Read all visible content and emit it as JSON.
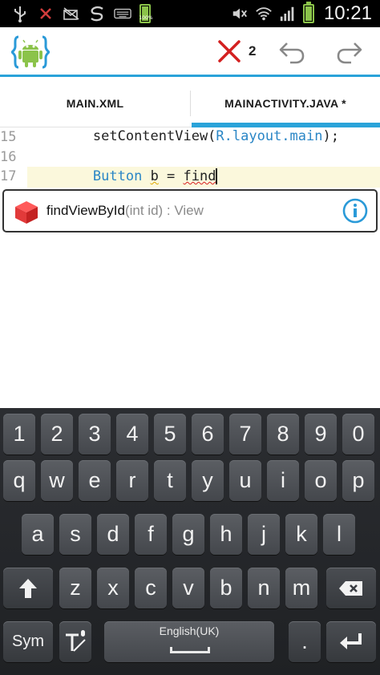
{
  "status_bar": {
    "time": "10:21",
    "icons": [
      "usb-icon",
      "no-sim-icon",
      "missed-email-icon",
      "sync-icon",
      "keyboard-icon",
      "battery-full-icon",
      "mute-icon",
      "wifi-icon",
      "signal-icon",
      "battery-icon"
    ],
    "battery_percent_small": "100%"
  },
  "action_bar": {
    "error_count": "2",
    "icons": [
      "android-logo-icon",
      "error-x-icon",
      "undo-icon",
      "redo-icon"
    ]
  },
  "tabs": [
    {
      "label": "MAIN.XML",
      "selected": false
    },
    {
      "label": "MAINACTIVITY.JAVA *",
      "selected": true
    }
  ],
  "editor": {
    "lines": [
      {
        "number": "15",
        "indent": "        ",
        "tokens": [
          {
            "text": "setContentView(",
            "kind": "plain"
          },
          {
            "text": "R.layout.main",
            "kind": "kw"
          },
          {
            "text": ");",
            "kind": "plain"
          }
        ]
      },
      {
        "number": "16",
        "indent": "",
        "tokens": []
      },
      {
        "number": "17",
        "indent": "        ",
        "tokens": [
          {
            "text": "Button",
            "kind": "kw"
          },
          {
            "text": " ",
            "kind": "plain"
          },
          {
            "text": "b",
            "kind": "warn"
          },
          {
            "text": " = ",
            "kind": "plain"
          },
          {
            "text": "find",
            "kind": "err"
          }
        ]
      }
    ]
  },
  "autocomplete": {
    "method": "findViewById",
    "signature": "(int id) : View",
    "icons": [
      "cube-method-icon",
      "info-icon"
    ]
  },
  "keyboard": {
    "row1": [
      "1",
      "2",
      "3",
      "4",
      "5",
      "6",
      "7",
      "8",
      "9",
      "0"
    ],
    "row2": [
      "q",
      "w",
      "e",
      "r",
      "t",
      "y",
      "u",
      "i",
      "o",
      "p"
    ],
    "row3": [
      "a",
      "s",
      "d",
      "f",
      "g",
      "h",
      "j",
      "k",
      "l"
    ],
    "row4": [
      "z",
      "x",
      "c",
      "v",
      "b",
      "n",
      "m"
    ],
    "sym_label": "Sym",
    "space_label": "English(UK)",
    "period_label": ".",
    "colors": {
      "background": "#2b2d31",
      "key": "#505358"
    }
  }
}
